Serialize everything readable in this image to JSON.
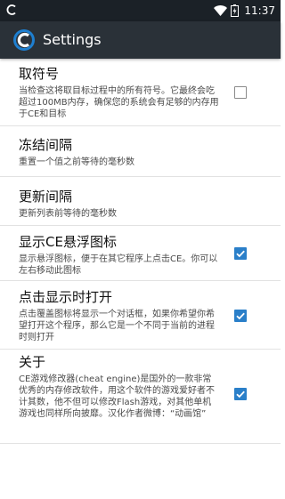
{
  "status_bar": {
    "time": "11:37",
    "icons": [
      "app-notification-icon",
      "wifi-icon",
      "battery-icon"
    ]
  },
  "toolbar": {
    "title": "Settings",
    "icon": "cheat-engine-logo-icon"
  },
  "preferences": [
    {
      "title": "取符号",
      "summary": "当检查这将取目标过程中的所有符号。它最终会吃超过100MB内存，确保您的系统会有足够的内存用于CE和目标",
      "checkbox": true,
      "checked": false
    },
    {
      "title": "冻结间隔",
      "summary": "重置一个值之前等待的毫秒数",
      "checkbox": false
    },
    {
      "title": "更新间隔",
      "summary": "更新列表前等待的毫秒数",
      "checkbox": false
    },
    {
      "title": "显示CE悬浮图标",
      "summary": "显示悬浮图标，便于在其它程序上点击CE。你可以左右移动此图标",
      "checkbox": true,
      "checked": true
    },
    {
      "title": "点击显示时打开",
      "summary": "点击覆盖图标将显示一个对话框，如果你希望你希望打开这个程序，那么它是一个不同于当前的进程时则打开",
      "checkbox": true,
      "checked": true
    },
    {
      "title": "关于",
      "summary": "CE游戏修改器(cheat engine)是国外的一款非常优秀的内存修改软件，用这个软件的游戏爱好者不计其数，他不但可以修改Flash游戏，对其他单机游戏也同样所向披靡。汉化作者微博：“动画馆”",
      "checkbox": true,
      "checked": true
    }
  ],
  "colors": {
    "status_bar": "#1b2127",
    "toolbar": "#2a3138",
    "checkbox_checked": "#2a7fc9",
    "divider": "#e2e2e2"
  }
}
